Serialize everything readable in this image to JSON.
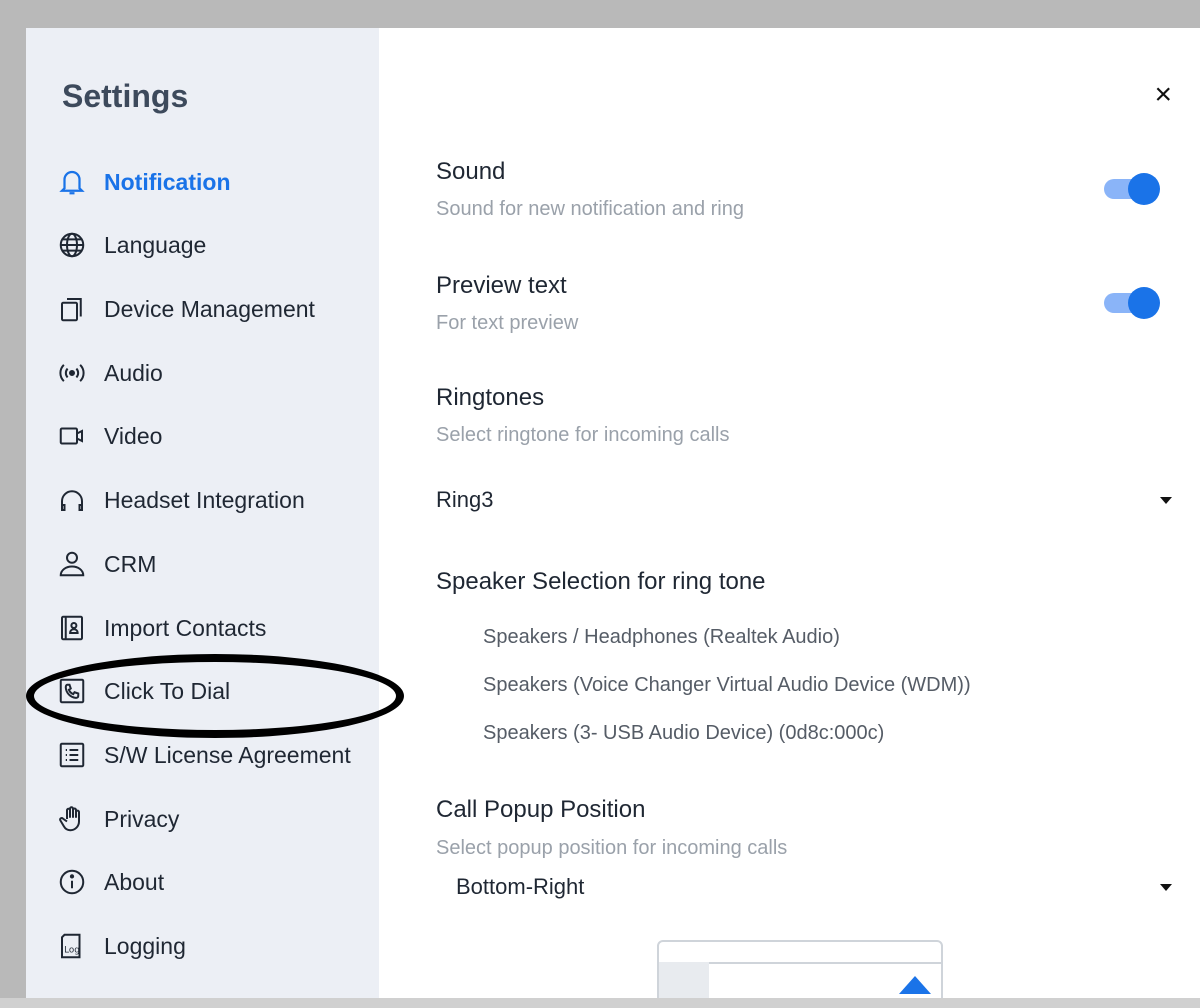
{
  "sidebar": {
    "title": "Settings",
    "items": [
      {
        "label": "Notification",
        "icon": "bell-icon",
        "active": true
      },
      {
        "label": "Language",
        "icon": "globe-icon"
      },
      {
        "label": "Device Management",
        "icon": "devices-icon"
      },
      {
        "label": "Audio",
        "icon": "audio-icon"
      },
      {
        "label": "Video",
        "icon": "video-icon"
      },
      {
        "label": "Headset Integration",
        "icon": "headset-icon"
      },
      {
        "label": "CRM",
        "icon": "user-icon"
      },
      {
        "label": "Import Contacts",
        "icon": "contact-card-icon"
      },
      {
        "label": "Click To Dial",
        "icon": "phone-icon"
      },
      {
        "label": "S/W License Agreement",
        "icon": "license-list-icon"
      },
      {
        "label": "Privacy",
        "icon": "hand-icon"
      },
      {
        "label": "About",
        "icon": "info-icon"
      },
      {
        "label": "Logging",
        "icon": "log-icon"
      }
    ]
  },
  "log_icon_text": "Log",
  "close_label": "×",
  "sound": {
    "title": "Sound",
    "desc": "Sound for new notification and ring",
    "enabled": true
  },
  "preview": {
    "title": "Preview text",
    "desc": "For text preview",
    "enabled": true
  },
  "ringtones": {
    "title": "Ringtones",
    "desc": "Select ringtone for incoming calls",
    "value": "Ring3"
  },
  "speaker": {
    "title": "Speaker Selection for ring tone",
    "options": [
      "Speakers / Headphones (Realtek Audio)",
      "Speakers (Voice Changer Virtual Audio Device (WDM))",
      "Speakers (3- USB Audio Device) (0d8c:000c)"
    ]
  },
  "popup": {
    "title": "Call Popup Position",
    "desc": "Select popup position for incoming calls",
    "value": "Bottom-Right"
  },
  "colors": {
    "accent": "#1a73e8",
    "sidebar_bg": "#eceff5"
  }
}
